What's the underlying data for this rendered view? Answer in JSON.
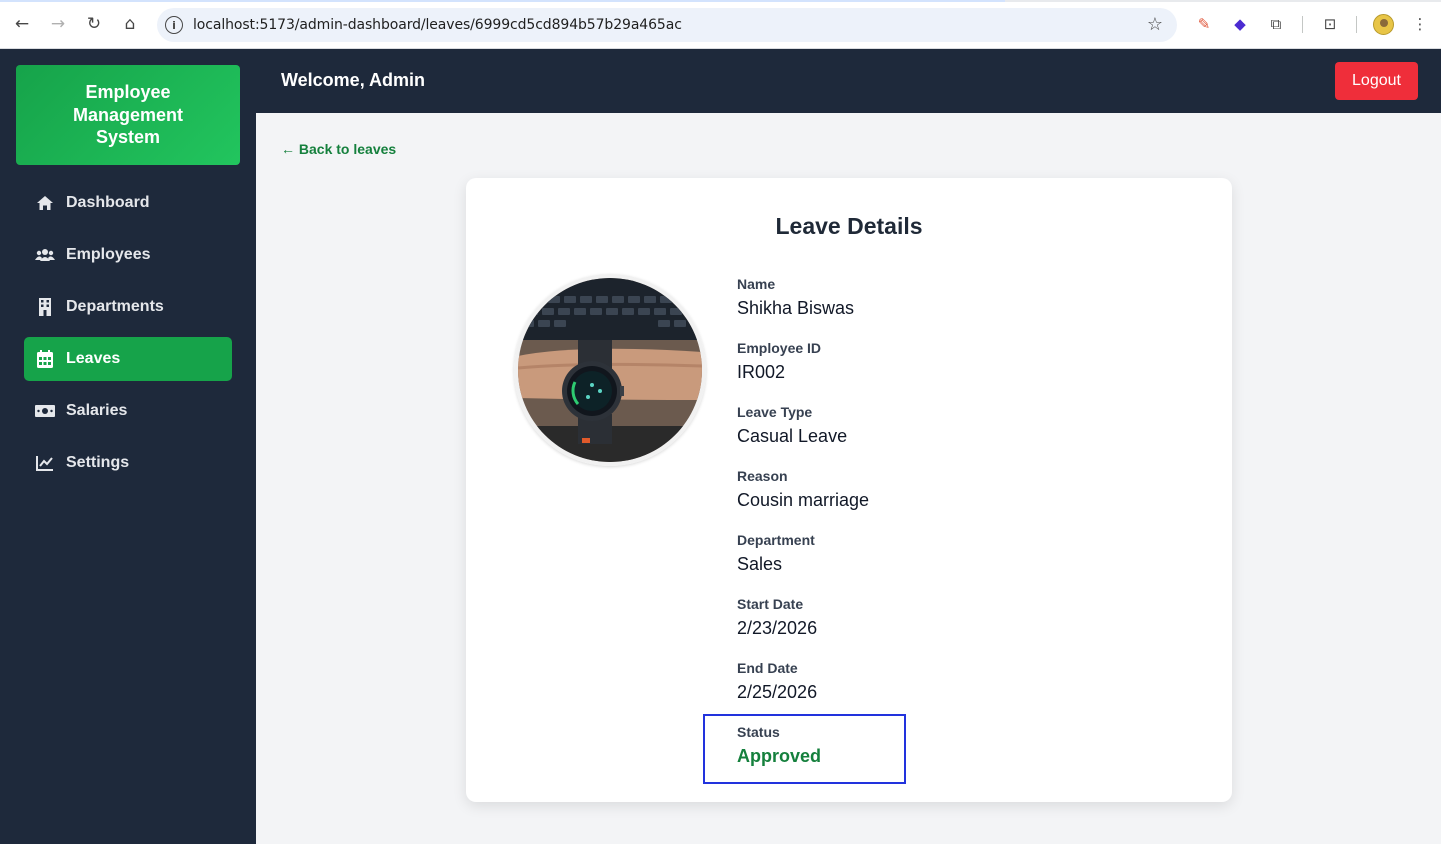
{
  "browser": {
    "url": "localhost:5173/admin-dashboard/leaves/6999cd5cd894b57b29a465ac"
  },
  "sidebar": {
    "brand": "Employee Management System",
    "items": [
      {
        "label": "Dashboard",
        "icon": "home-icon"
      },
      {
        "label": "Employees",
        "icon": "users-icon"
      },
      {
        "label": "Departments",
        "icon": "building-icon"
      },
      {
        "label": "Leaves",
        "icon": "calendar-icon",
        "active": true
      },
      {
        "label": "Salaries",
        "icon": "money-bill-icon"
      },
      {
        "label": "Settings",
        "icon": "chart-line-icon"
      }
    ]
  },
  "header": {
    "welcome": "Welcome, Admin",
    "logout_label": "Logout"
  },
  "main": {
    "back_label": "← Back to leaves",
    "title": "Leave Details",
    "fields": [
      {
        "label": "Name",
        "value": "Shikha Biswas"
      },
      {
        "label": "Employee ID",
        "value": "IR002"
      },
      {
        "label": "Leave Type",
        "value": "Casual Leave"
      },
      {
        "label": "Reason",
        "value": "Cousin marriage"
      },
      {
        "label": "Department",
        "value": "Sales"
      },
      {
        "label": "Start Date",
        "value": "2/23/2026"
      },
      {
        "label": "End Date",
        "value": "2/25/2026"
      },
      {
        "label": "Status",
        "value": "Approved"
      }
    ]
  },
  "colors": {
    "sidebar_bg": "#1e293b",
    "accent_green": "#16a34a",
    "logout_red": "#ef2e3a",
    "status_approved": "#15803d"
  }
}
